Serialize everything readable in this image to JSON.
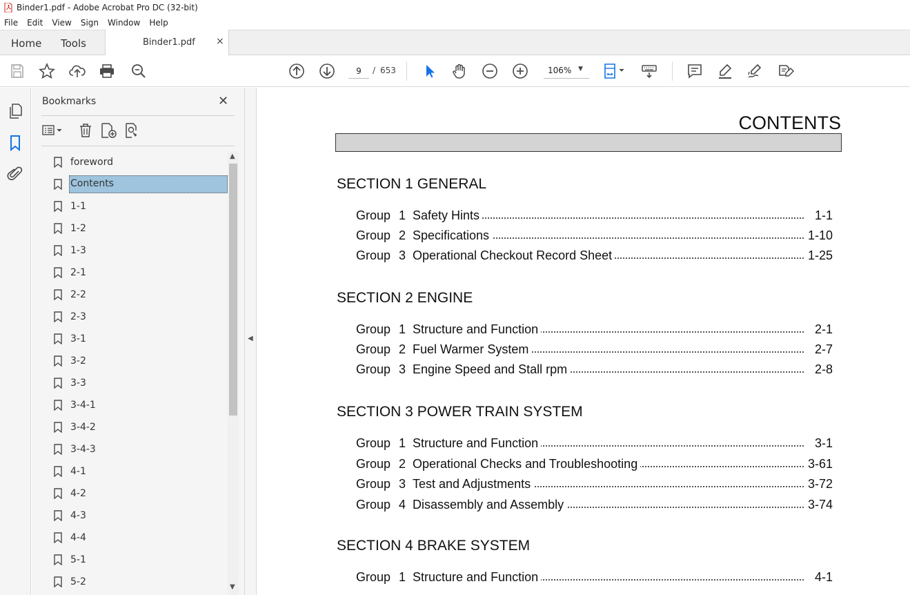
{
  "window": {
    "title": "Binder1.pdf - Adobe Acrobat Pro DC (32-bit)"
  },
  "menu": [
    "File",
    "Edit",
    "View",
    "Sign",
    "Window",
    "Help"
  ],
  "tabs": {
    "home": "Home",
    "tools": "Tools",
    "document": "Binder1.pdf",
    "close": "×"
  },
  "toolbar": {
    "current_page": "9",
    "page_separator": "/",
    "total_pages": "653",
    "zoom": "106%",
    "icons": [
      "save-icon",
      "star-icon",
      "upload-icon",
      "print-icon",
      "search-zoom-icon",
      "page-up-icon",
      "page-down-icon",
      "select-cursor-icon",
      "hand-icon",
      "zoom-out-icon",
      "zoom-in-icon",
      "fit-page-icon",
      "keyboard-icon",
      "comment-icon",
      "highlight-pen-icon",
      "draw-icon",
      "edit-stamp-icon"
    ]
  },
  "bookmarks": {
    "title": "Bookmarks",
    "close": "✕",
    "items": [
      "foreword",
      "Contents",
      "1-1",
      "1-2",
      "1-3",
      "2-1",
      "2-2",
      "2-3",
      "3-1",
      "3-2",
      "3-3",
      "3-4-1",
      "3-4-2",
      "3-4-3",
      "4-1",
      "4-2",
      "4-3",
      "4-4",
      "5-1",
      "5-2"
    ],
    "selected": "Contents"
  },
  "document": {
    "heading": "CONTENTS",
    "sections": [
      {
        "title": "SECTION 1  GENERAL",
        "groups": [
          {
            "num": "1",
            "text": "Safety Hints",
            "page": "1-1"
          },
          {
            "num": "2",
            "text": "Specifications",
            "page": "1-10"
          },
          {
            "num": "3",
            "text": "Operational Checkout Record Sheet",
            "page": "1-25"
          }
        ]
      },
      {
        "title": "SECTION 2  ENGINE",
        "groups": [
          {
            "num": "1",
            "text": "Structure and Function",
            "page": "2-1"
          },
          {
            "num": "2",
            "text": "Fuel Warmer System",
            "page": "2-7"
          },
          {
            "num": "3",
            "text": "Engine Speed and Stall rpm",
            "page": "2-8"
          }
        ]
      },
      {
        "title": "SECTION 3  POWER TRAIN SYSTEM",
        "groups": [
          {
            "num": "1",
            "text": "Structure and Function",
            "page": "3-1"
          },
          {
            "num": "2",
            "text": "Operational Checks and Troubleshooting",
            "page": "3-61"
          },
          {
            "num": "3",
            "text": "Test and Adjustments",
            "page": "3-72"
          },
          {
            "num": "4",
            "text": "Disassembly and Assembly",
            "page": "3-74"
          }
        ]
      },
      {
        "title": "SECTION 4  BRAKE SYSTEM",
        "groups": [
          {
            "num": "1",
            "text": "Structure and Function",
            "page": "4-1"
          }
        ]
      }
    ],
    "group_word": "Group"
  },
  "colors": {
    "selection": "#9ec4de",
    "icon": "#4a4a4a",
    "accent": "#1473e6",
    "pdf_red": "#d4231d"
  }
}
